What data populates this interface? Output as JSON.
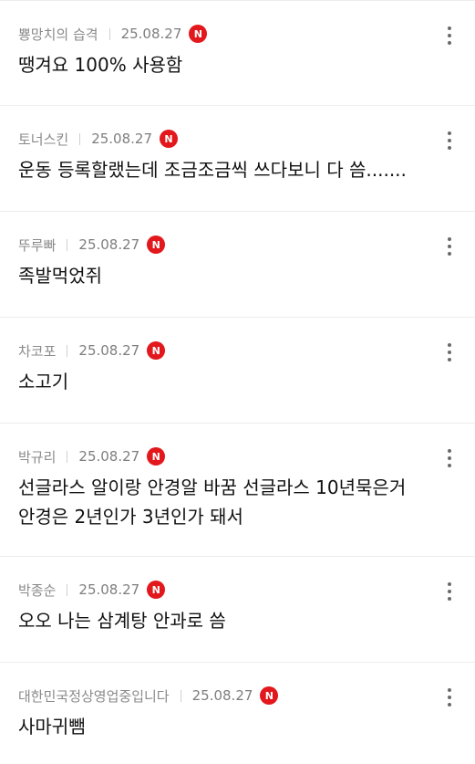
{
  "comments": [
    {
      "author": "뿅망치의 습격",
      "date": "25.08.27",
      "badge": "N",
      "text": "땡겨요 100% 사용함"
    },
    {
      "author": "토너스킨",
      "date": "25.08.27",
      "badge": "N",
      "text": "운동 등록할랬는데 조금조금씩 쓰다보니 다 씀......."
    },
    {
      "author": "뚜루빠",
      "date": "25.08.27",
      "badge": "N",
      "text": "족발먹었쥐"
    },
    {
      "author": "차코포",
      "date": "25.08.27",
      "badge": "N",
      "text": "소고기"
    },
    {
      "author": "박규리",
      "date": "25.08.27",
      "badge": "N",
      "text": "선글라스 알이랑 안경알 바꿈 선글라스 10년묵은거 안경은 2년인가 3년인가 돼서"
    },
    {
      "author": "박종순",
      "date": "25.08.27",
      "badge": "N",
      "text": "오오 나는 삼계탕 안과로 씀"
    },
    {
      "author": "대한민국정상영업중입니다",
      "date": "25.08.27",
      "badge": "N",
      "text": "사마귀뺌"
    }
  ],
  "icons": {
    "more": "more-vertical-icon",
    "new_badge_color": "#e2181c"
  }
}
